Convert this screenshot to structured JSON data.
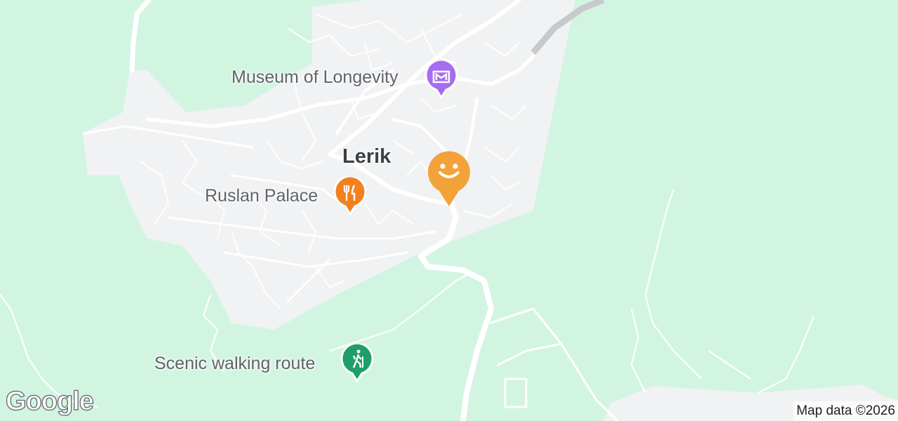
{
  "map": {
    "city_label": "Lerik",
    "pois": [
      {
        "name": "Museum of Longevity",
        "category": "museum-icon",
        "color": "#a56cf0"
      },
      {
        "name": "Ruslan Palace",
        "category": "restaurant-icon",
        "color": "#f2811d"
      },
      {
        "name": "Scenic walking route",
        "category": "hiking-icon",
        "color": "#1e9e6a"
      }
    ],
    "current_location_marker": {
      "icon": "smiley-icon",
      "color": "#f3a23a"
    },
    "colors": {
      "land": "#d2f5e2",
      "urban": "#f1f2f3",
      "road": "#ffffff",
      "highway": "#c8c9cb"
    }
  },
  "logo": "Google",
  "attribution": "Map data ©2026"
}
